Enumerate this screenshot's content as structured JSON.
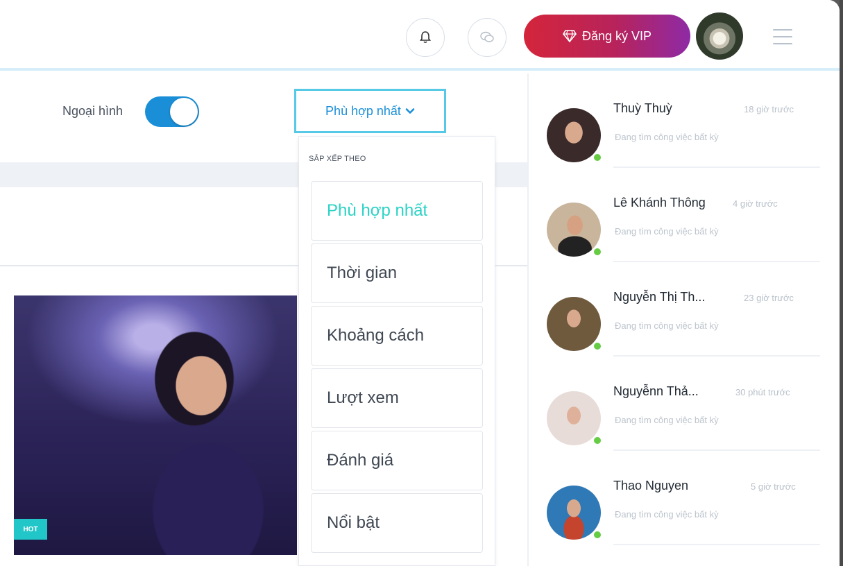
{
  "header": {
    "bell_icon": "bell-icon",
    "chat_icon": "chat-bubbles-icon",
    "vip_label": "Đăng ký VIP",
    "vip_icon": "diamond-icon",
    "menu_icon": "hamburger-icon",
    "accent_gradient": [
      "#d4253b",
      "#8e2aa6"
    ]
  },
  "filters": {
    "toggle_label": "Ngoại hình",
    "toggle_on": true,
    "sort_selected": "Phù hợp nhất"
  },
  "dropdown": {
    "title": "SẮP XẾP THEO",
    "options": [
      {
        "label": "Phù hợp nhất",
        "selected": true
      },
      {
        "label": "Thời gian",
        "selected": false
      },
      {
        "label": "Khoảng cách",
        "selected": false
      },
      {
        "label": "Lượt xem",
        "selected": false
      },
      {
        "label": "Đánh giá",
        "selected": false
      },
      {
        "label": "Nổi bật",
        "selected": false
      }
    ]
  },
  "card": {
    "badge": "HOT"
  },
  "contacts": [
    {
      "name": "Thuỳ Thuỳ",
      "time": "18 giờ trước",
      "status": "Đang tìm công việc bất kỳ",
      "online": true
    },
    {
      "name": "Lê Khánh Thông",
      "time": "4 giờ trước",
      "status": "Đang tìm công việc bất kỳ",
      "online": true
    },
    {
      "name": "Nguyễn Thị Th...",
      "time": "23 giờ trước",
      "status": "Đang tìm công việc bất kỳ",
      "online": true
    },
    {
      "name": "Nguyễnn Thả...",
      "time": "30 phút trước",
      "status": "Đang tìm công việc bất kỳ",
      "online": true
    },
    {
      "name": "Thao Nguyen",
      "time": "5 giờ trước",
      "status": "Đang tìm công việc bất kỳ",
      "online": true
    }
  ]
}
